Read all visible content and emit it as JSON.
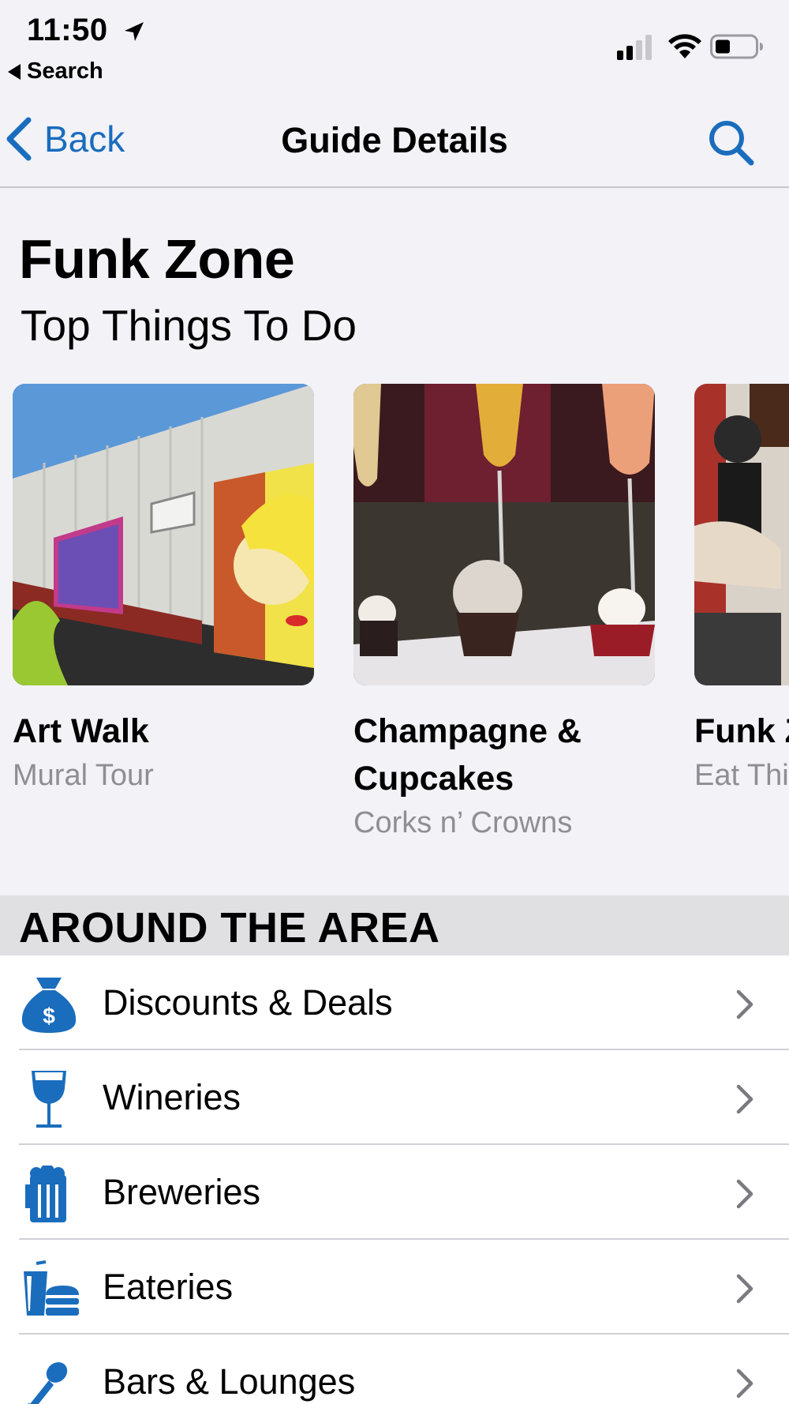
{
  "status_bar": {
    "time": "11:50",
    "back_app": "Search"
  },
  "nav": {
    "back_label": "Back",
    "title": "Guide Details"
  },
  "header": {
    "title": "Funk Zone",
    "subtitle": "Top Things To Do"
  },
  "carousel": [
    {
      "title": "Art Walk",
      "subtitle": "Mural Tour"
    },
    {
      "title": "Champagne & Cupcakes",
      "subtitle": "Corks n’ Crowns"
    },
    {
      "title": "Funk Zone Tour",
      "subtitle": "Eat This"
    }
  ],
  "section": {
    "title": "AROUND THE AREA"
  },
  "list": [
    {
      "label": "Discounts & Deals",
      "icon": "money-bag-icon"
    },
    {
      "label": "Wineries",
      "icon": "wine-glass-icon"
    },
    {
      "label": "Breweries",
      "icon": "beer-mug-icon"
    },
    {
      "label": "Eateries",
      "icon": "drink-burger-icon"
    },
    {
      "label": "Bars & Lounges",
      "icon": "microphone-icon"
    }
  ],
  "colors": {
    "accent": "#1a6dbd",
    "background": "#f2f2f7",
    "section_bg": "#e0e0e3",
    "secondary_text": "#8e8e93"
  }
}
